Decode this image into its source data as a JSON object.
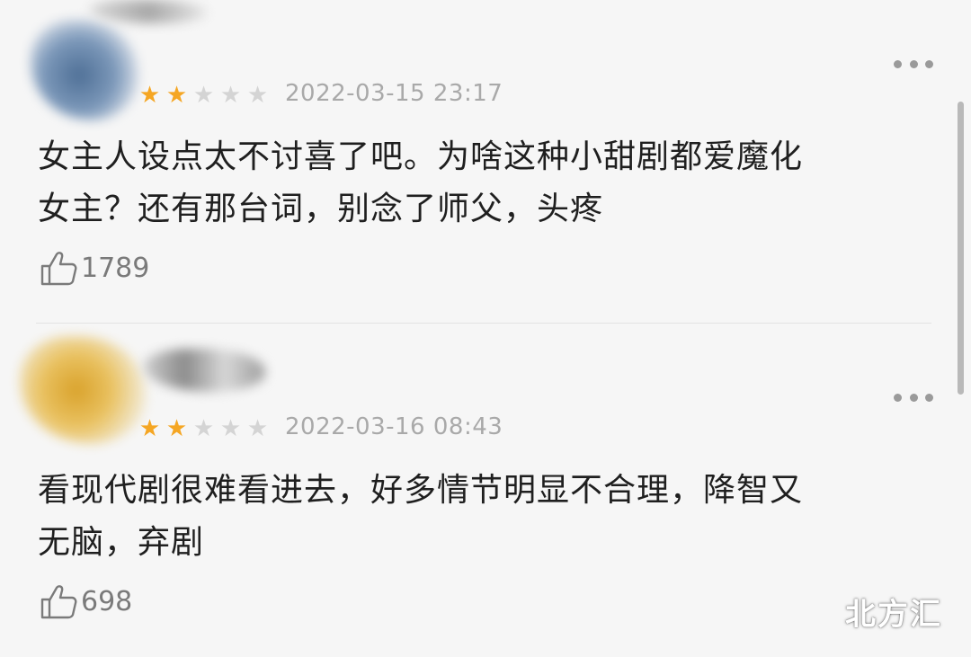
{
  "comments": [
    {
      "rating": 2,
      "max_rating": 5,
      "timestamp": "2022-03-15 23:17",
      "text_line1": "女主人设点太不讨喜了吧。为啥这种小甜剧都爱魔化",
      "text_line2": "女主？还有那台词，别念了师父，头疼",
      "likes": "1789",
      "avatar_color": "#5b7fa8"
    },
    {
      "rating": 2,
      "max_rating": 5,
      "timestamp": "2022-03-16 08:43",
      "text_line1": "看现代剧很难看进去，好多情节明显不合理，降智又",
      "text_line2": "无脑，弃剧",
      "likes": "698",
      "avatar_color": "#e0b03a"
    }
  ],
  "icons": {
    "star": "★",
    "more": "more-dots-icon",
    "like": "thumbs-up-icon"
  },
  "colors": {
    "star_on": "#f5a623",
    "star_off": "#d4d4d4",
    "background": "#f6f6f6"
  },
  "watermark": "北方汇"
}
